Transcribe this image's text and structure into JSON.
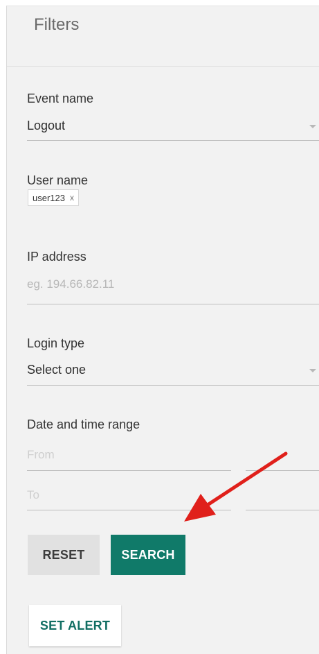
{
  "filters": {
    "title": "Filters",
    "event_name": {
      "label": "Event name",
      "value": "Logout"
    },
    "user_name": {
      "label": "User name",
      "chip": "user123",
      "chip_remove": "x"
    },
    "ip_address": {
      "label": "IP address",
      "placeholder": "eg. 194.66.82.11"
    },
    "login_type": {
      "label": "Login type",
      "value": "Select one"
    },
    "date_range": {
      "label": "Date and time range",
      "from_placeholder": "From",
      "to_placeholder": "To"
    }
  },
  "buttons": {
    "reset": "RESET",
    "search": "SEARCH",
    "set_alert": "SET ALERT"
  },
  "colors": {
    "accent": "#107a69",
    "arrow": "#e0201b"
  },
  "icons": {
    "dropdown": "chevron-down-icon",
    "chip_remove": "close-icon"
  }
}
